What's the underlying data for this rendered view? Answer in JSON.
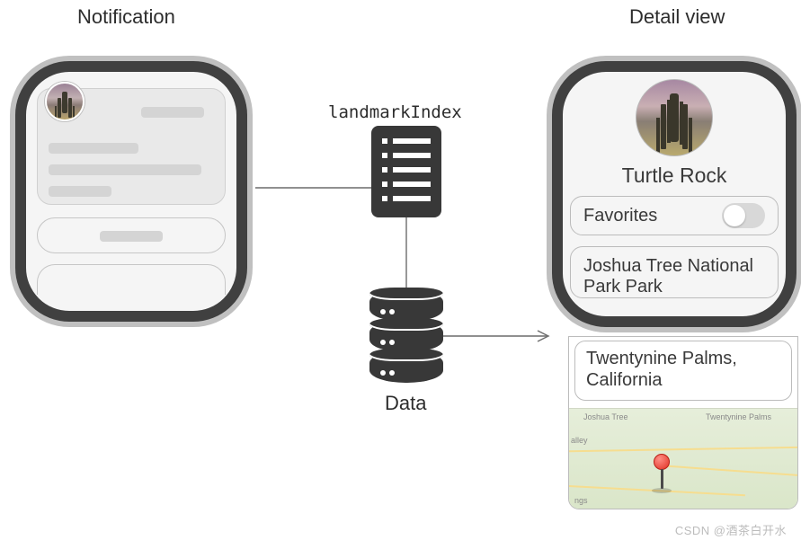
{
  "labels": {
    "notification": "Notification",
    "detail_view": "Detail view",
    "landmark_index": "landmarkIndex",
    "data": "Data"
  },
  "detail": {
    "title": "Turtle Rock",
    "favorites_label": "Favorites",
    "favorites_on": false,
    "park": "Joshua Tree National Park Park",
    "location": "Twentynine Palms, California"
  },
  "map": {
    "labels": {
      "tl": "Joshua Tree",
      "tr": "Twentynine Palms",
      "left": "alley",
      "bl": "ngs"
    }
  },
  "watermark": "CSDN @酒茶白开水"
}
